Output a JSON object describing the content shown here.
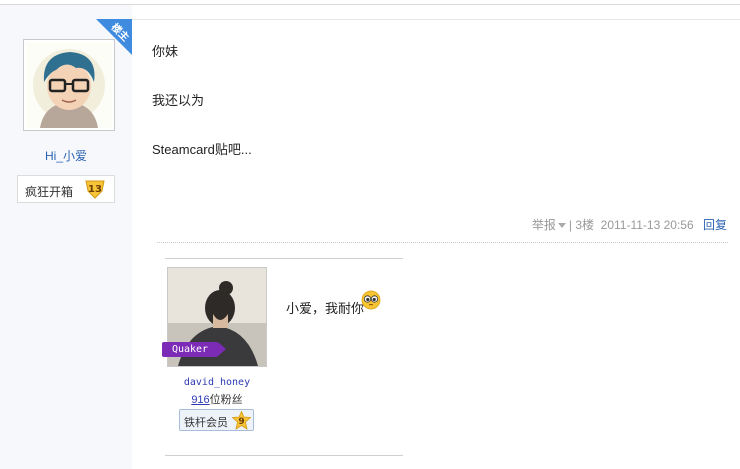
{
  "post": {
    "author": {
      "name": "Hi_小爱",
      "badge": "楼主",
      "level_title": "疯狂开箱",
      "level": "13"
    },
    "content": [
      "你妹",
      "我还以为",
      "Steamcard贴吧..."
    ],
    "meta": {
      "report": "举报",
      "floor": "3楼",
      "timestamp": "2011-11-13 20:56",
      "reply": "回复"
    }
  },
  "sub_post": {
    "user": {
      "tag": "Quaker",
      "name": "david_honey",
      "fans_count": "916",
      "fans_suffix": "位粉丝",
      "member_title": "铁杆会员",
      "member_level": "9"
    },
    "text": "小爱，我耐你"
  },
  "colors": {
    "link": "#2d64b3",
    "badge_blue": "#3f8be0",
    "tag_purple": "#7b2bb6"
  }
}
